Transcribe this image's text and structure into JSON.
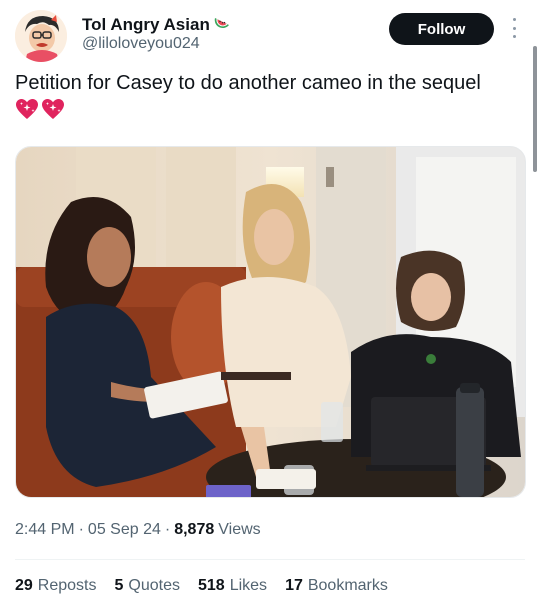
{
  "author": {
    "display_name": "Tol Angry Asian",
    "name_emoji": "watermelon-icon",
    "handle": "@liloloveyou024"
  },
  "follow_button": {
    "label": "Follow"
  },
  "tweet": {
    "text": "Petition for Casey to do another cameo in the sequel",
    "emojis": [
      "sparkling-heart-icon",
      "sparkling-heart-icon"
    ]
  },
  "meta": {
    "time": "2:44 PM",
    "separator": "·",
    "date": "05 Sep 24",
    "views_count": "8,878",
    "views_label": "Views"
  },
  "stats": [
    {
      "count": "29",
      "label": "Reposts"
    },
    {
      "count": "5",
      "label": "Quotes"
    },
    {
      "count": "518",
      "label": "Likes"
    },
    {
      "count": "17",
      "label": "Bookmarks"
    }
  ],
  "colors": {
    "text_primary": "#0f1419",
    "text_secondary": "#536471",
    "follow_bg": "#0f1419",
    "heart_pink": "#e0245e"
  }
}
